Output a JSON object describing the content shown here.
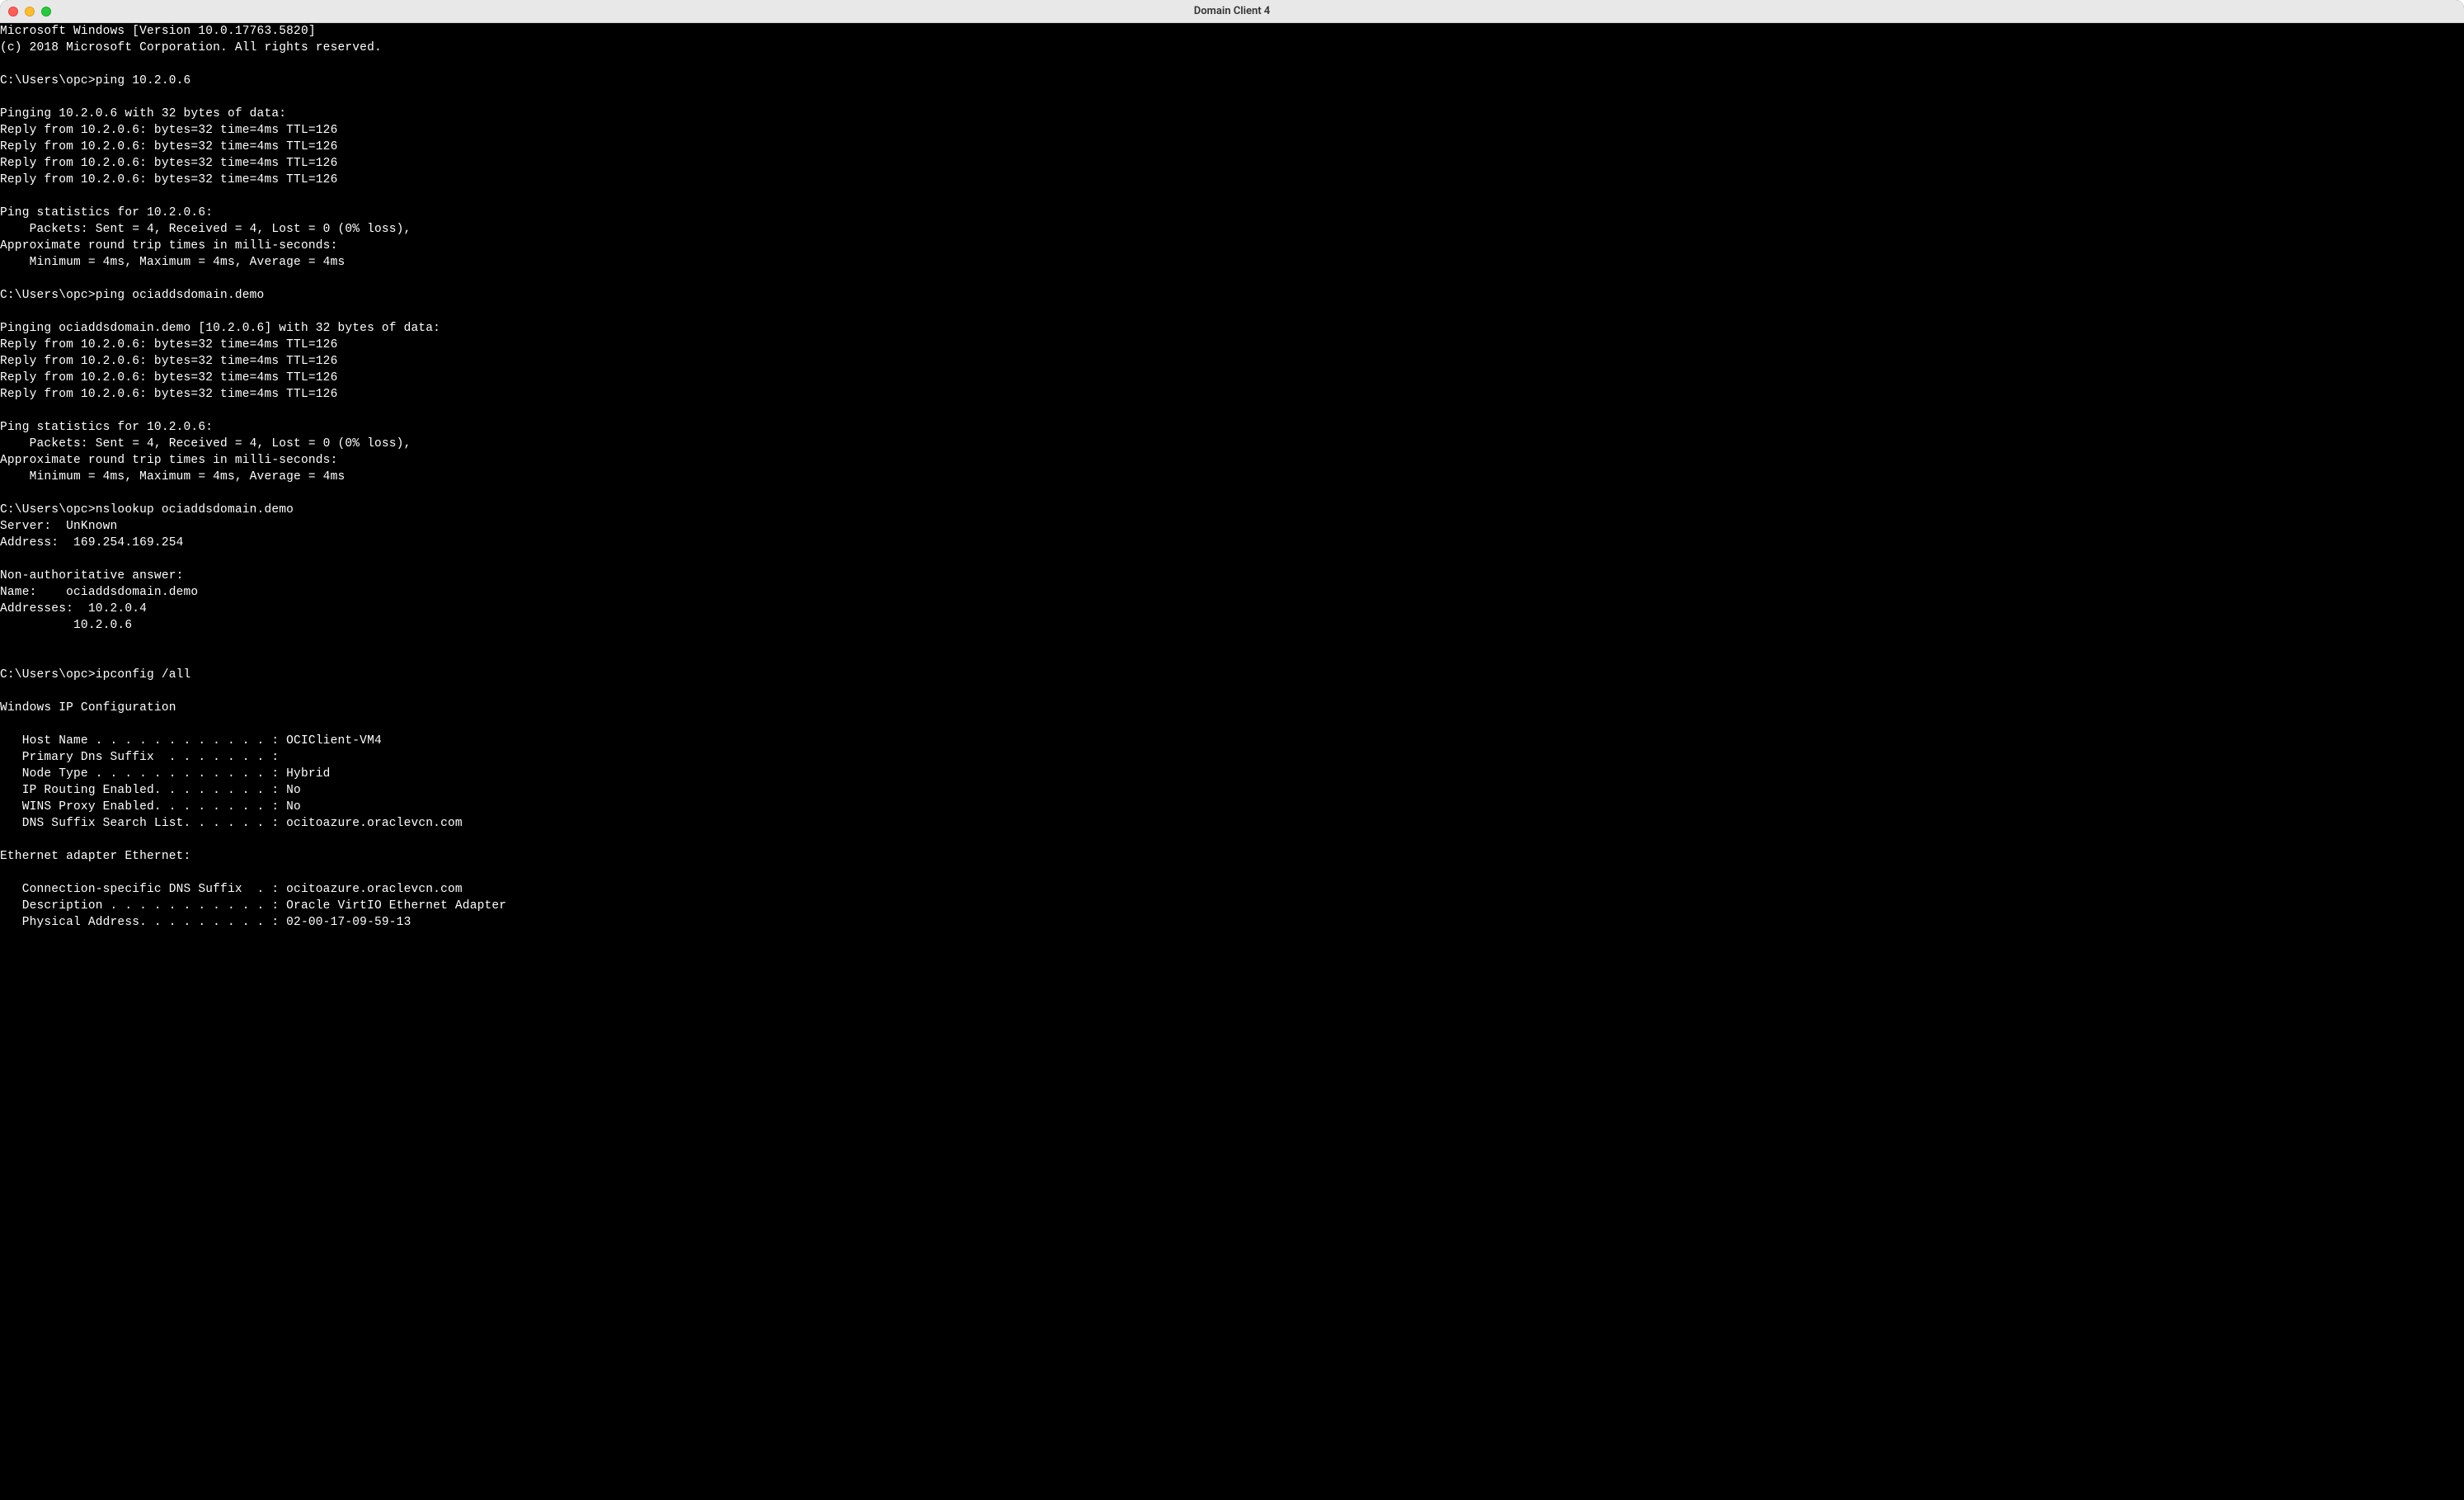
{
  "window": {
    "title": "Domain Client 4"
  },
  "terminal": {
    "lines": [
      "Microsoft Windows [Version 10.0.17763.5820]",
      "(c) 2018 Microsoft Corporation. All rights reserved.",
      "",
      "C:\\Users\\opc>ping 10.2.0.6",
      "",
      "Pinging 10.2.0.6 with 32 bytes of data:",
      "Reply from 10.2.0.6: bytes=32 time=4ms TTL=126",
      "Reply from 10.2.0.6: bytes=32 time=4ms TTL=126",
      "Reply from 10.2.0.6: bytes=32 time=4ms TTL=126",
      "Reply from 10.2.0.6: bytes=32 time=4ms TTL=126",
      "",
      "Ping statistics for 10.2.0.6:",
      "    Packets: Sent = 4, Received = 4, Lost = 0 (0% loss),",
      "Approximate round trip times in milli-seconds:",
      "    Minimum = 4ms, Maximum = 4ms, Average = 4ms",
      "",
      "C:\\Users\\opc>ping ociaddsdomain.demo",
      "",
      "Pinging ociaddsdomain.demo [10.2.0.6] with 32 bytes of data:",
      "Reply from 10.2.0.6: bytes=32 time=4ms TTL=126",
      "Reply from 10.2.0.6: bytes=32 time=4ms TTL=126",
      "Reply from 10.2.0.6: bytes=32 time=4ms TTL=126",
      "Reply from 10.2.0.6: bytes=32 time=4ms TTL=126",
      "",
      "Ping statistics for 10.2.0.6:",
      "    Packets: Sent = 4, Received = 4, Lost = 0 (0% loss),",
      "Approximate round trip times in milli-seconds:",
      "    Minimum = 4ms, Maximum = 4ms, Average = 4ms",
      "",
      "C:\\Users\\opc>nslookup ociaddsdomain.demo",
      "Server:  UnKnown",
      "Address:  169.254.169.254",
      "",
      "Non-authoritative answer:",
      "Name:    ociaddsdomain.demo",
      "Addresses:  10.2.0.4",
      "          10.2.0.6",
      "",
      "",
      "C:\\Users\\opc>ipconfig /all",
      "",
      "Windows IP Configuration",
      "",
      "   Host Name . . . . . . . . . . . . : OCIClient-VM4",
      "   Primary Dns Suffix  . . . . . . . :",
      "   Node Type . . . . . . . . . . . . : Hybrid",
      "   IP Routing Enabled. . . . . . . . : No",
      "   WINS Proxy Enabled. . . . . . . . : No",
      "   DNS Suffix Search List. . . . . . : ocitoazure.oraclevcn.com",
      "",
      "Ethernet adapter Ethernet:",
      "",
      "   Connection-specific DNS Suffix  . : ocitoazure.oraclevcn.com",
      "   Description . . . . . . . . . . . : Oracle VirtIO Ethernet Adapter",
      "   Physical Address. . . . . . . . . : 02-00-17-09-59-13"
    ]
  }
}
